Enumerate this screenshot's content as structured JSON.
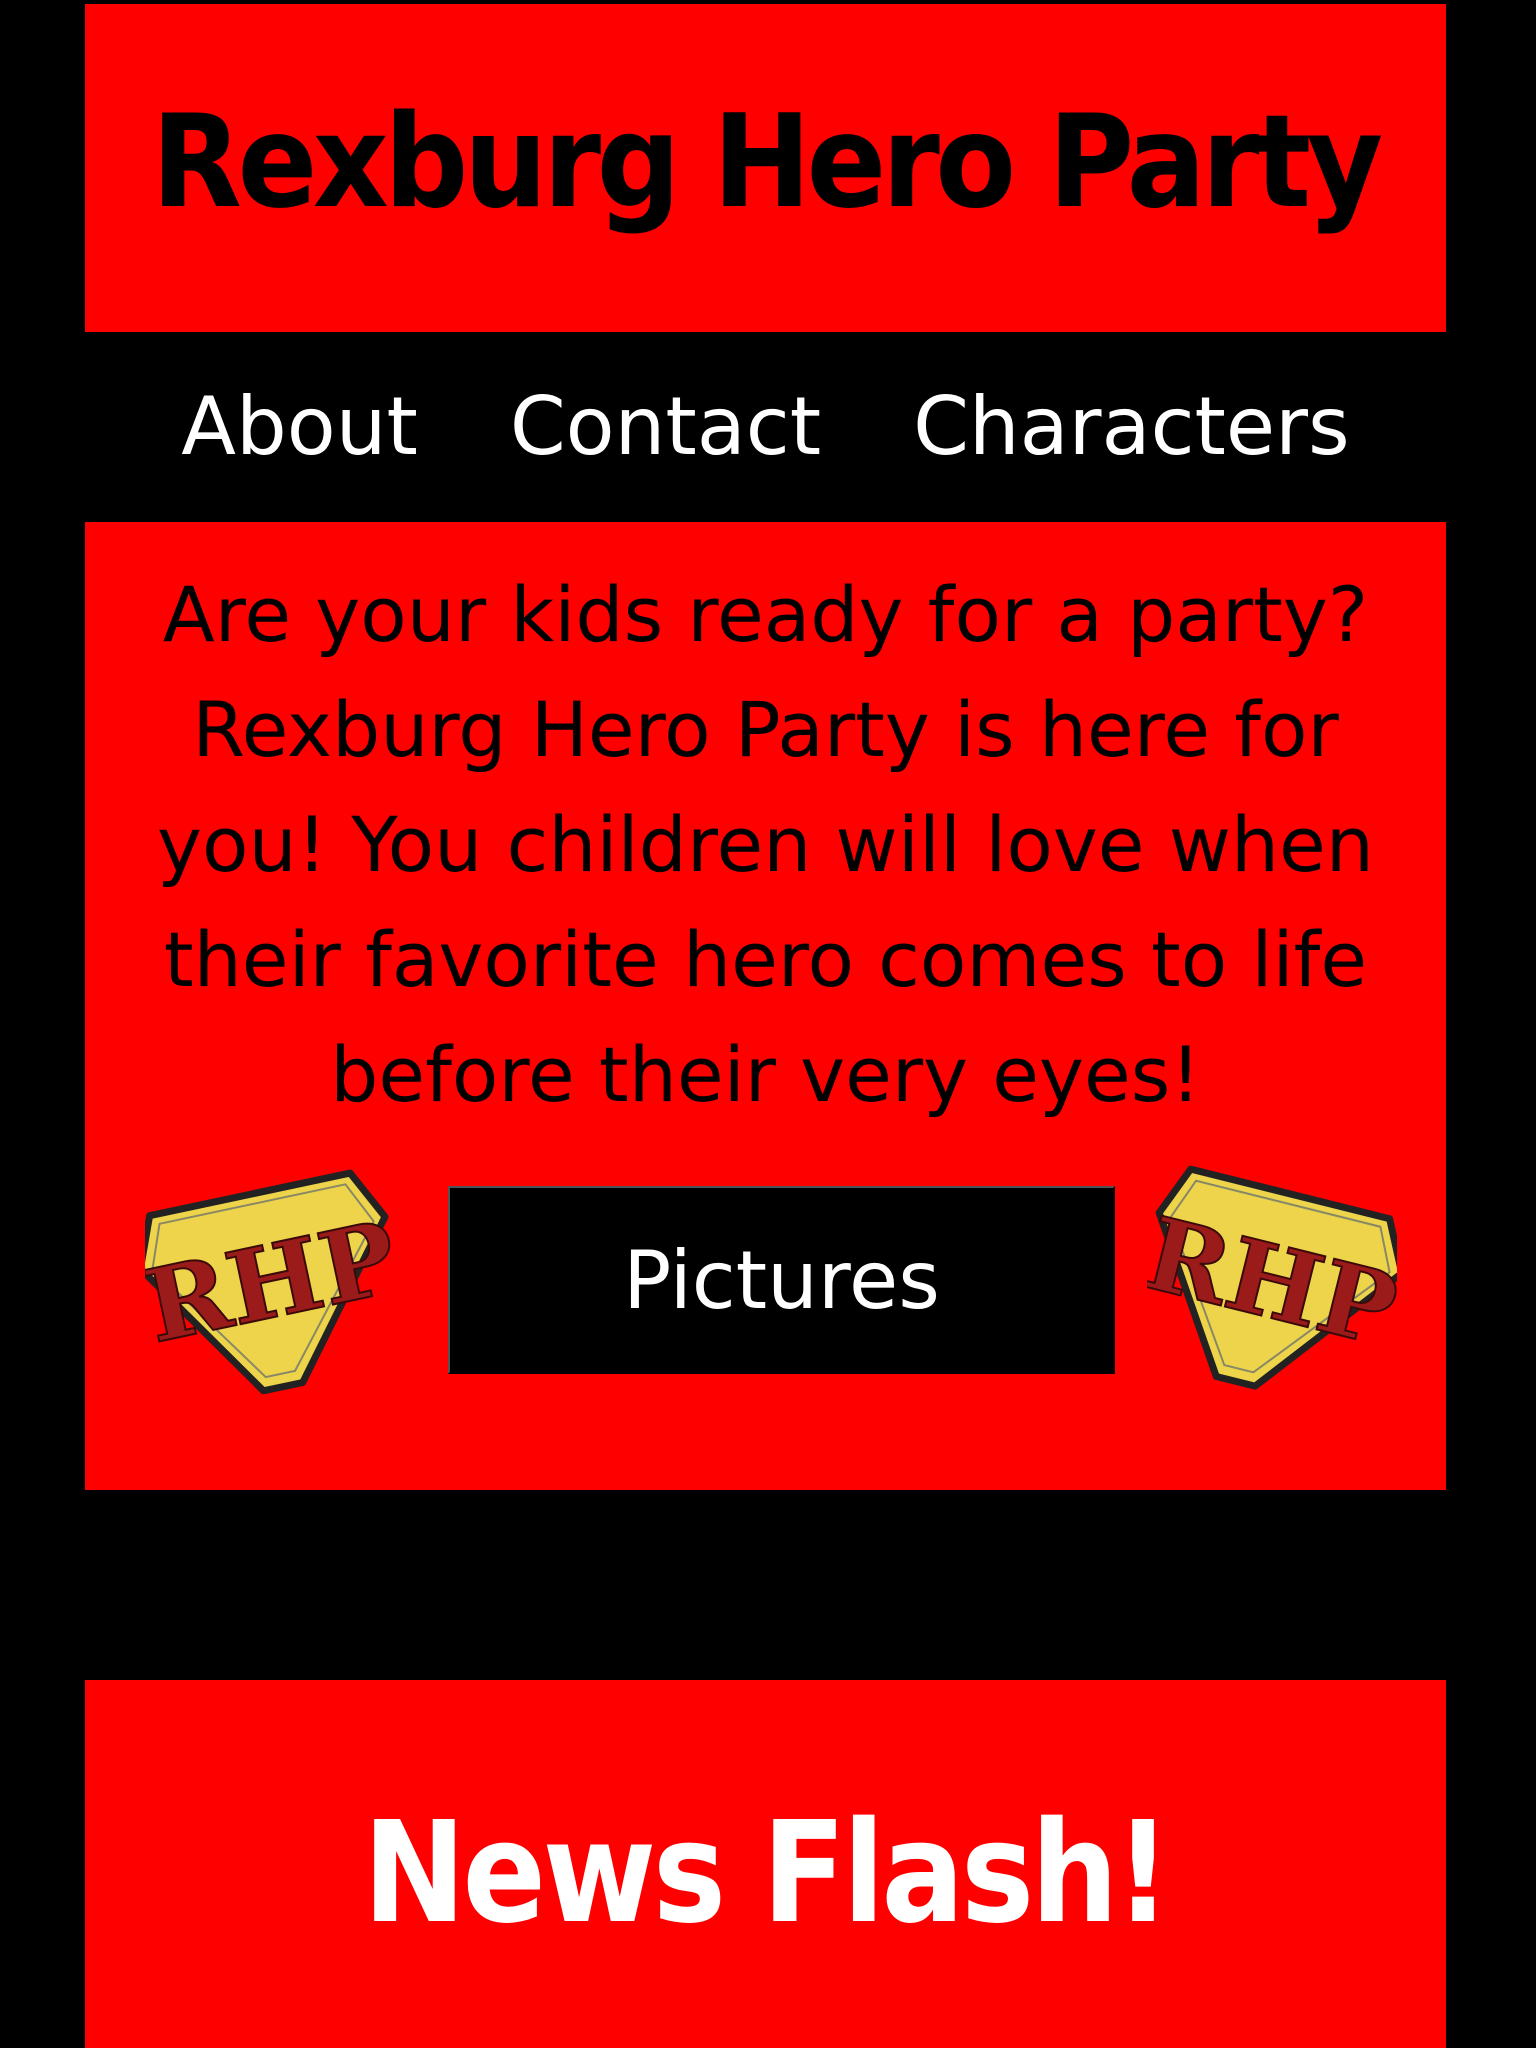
{
  "header": {
    "title": "Rexburg Hero Party"
  },
  "nav": {
    "items": [
      "About",
      "Contact",
      "Characters"
    ]
  },
  "main": {
    "intro": "Are your kids ready for a party? Rexburg Hero Party is here for you! You children will love when their favorite hero comes to life before their very eyes!",
    "button_label": "Pictures",
    "badge_text": "RHP"
  },
  "news": {
    "title": "News Flash!"
  },
  "colors": {
    "background": "#000000",
    "panel": "#ff0000",
    "badge_fill": "#eed44a",
    "badge_letters": "#9b1b1b"
  }
}
